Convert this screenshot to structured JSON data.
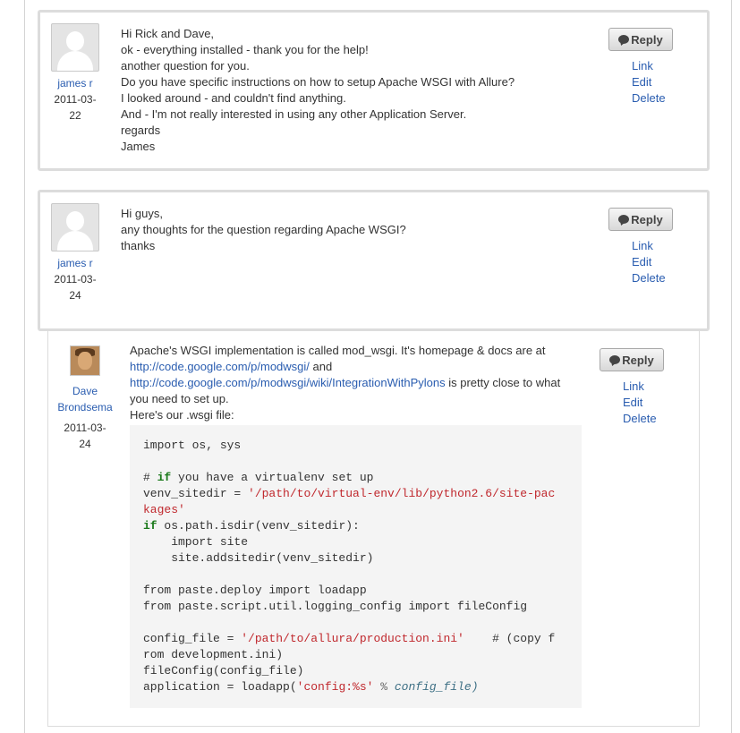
{
  "posts": [
    {
      "author": "james r",
      "date_line1": "2011-03-",
      "date_line2": "22",
      "lines": [
        "Hi Rick and Dave,",
        "ok - everything installed - thank you for the help!",
        "another question for you.",
        "Do you have specific instructions on how to setup Apache WSGI with Allure?",
        "I looked around - and couldn't find anything.",
        "And - I'm not really interested in using any other Application Server.",
        "regards",
        "James"
      ],
      "actions": {
        "reply": "Reply",
        "link": "Link",
        "edit": "Edit",
        "delete": "Delete"
      }
    },
    {
      "author": "james r",
      "date_line1": "2011-03-",
      "date_line2": "24",
      "lines": [
        "Hi guys,",
        "any thoughts for the question regarding Apache WSGI?",
        "thanks"
      ],
      "actions": {
        "reply": "Reply",
        "link": "Link",
        "edit": "Edit",
        "delete": "Delete"
      }
    },
    {
      "author_line1": "Dave",
      "author_line2": "Brondsema",
      "date_line1": "2011-03-",
      "date_line2": "24",
      "intro_1": "Apache's WSGI implementation is called mod_wsgi. It's homepage & docs are at",
      "link_1": "http://code.google.com/p/modwsgi/",
      "and_text": " and",
      "link_2": "http://code.google.com/p/modwsgi/wiki/IntegrationWithPylons",
      "intro_2_tail": " is pretty close to what",
      "intro_3": "you need to set up.",
      "intro_4": "Here's our .wsgi file:",
      "code": {
        "l1": "import os, sys",
        "l3_hash": "# ",
        "l3_kw": "if",
        "l3_rest": " you have a virtualenv set up",
        "l4_pre": "venv_sitedir = ",
        "l4_str": "'/path/to/virtual-env/lib/python2.6/site-pac",
        "l5_str": "kages'",
        "l6_kw": "if",
        "l6_rest": " os.path.isdir(venv_sitedir):",
        "l7": "    import site",
        "l8": "    site.addsitedir(venv_sitedir)",
        "l10": "from paste.deploy import loadapp",
        "l11": "from paste.script.util.logging_config import fileConfig",
        "l13_pre": "config_file = ",
        "l13_str": "'/path/to/allura/production.ini'",
        "l13_rest": "    # (copy f",
        "l14": "rom development.ini)",
        "l15": "fileConfig(config_file)",
        "l16_pre": "application = loadapp(",
        "l16_str": "'config:%s'",
        "l16_op": " % ",
        "l16_ital": "config_file)"
      },
      "actions": {
        "reply": "Reply",
        "link": "Link",
        "edit": "Edit",
        "delete": "Delete"
      }
    }
  ],
  "icons": {
    "avatar_generic": "user-silhouette-icon",
    "reply": "speech-bubble-icon"
  }
}
